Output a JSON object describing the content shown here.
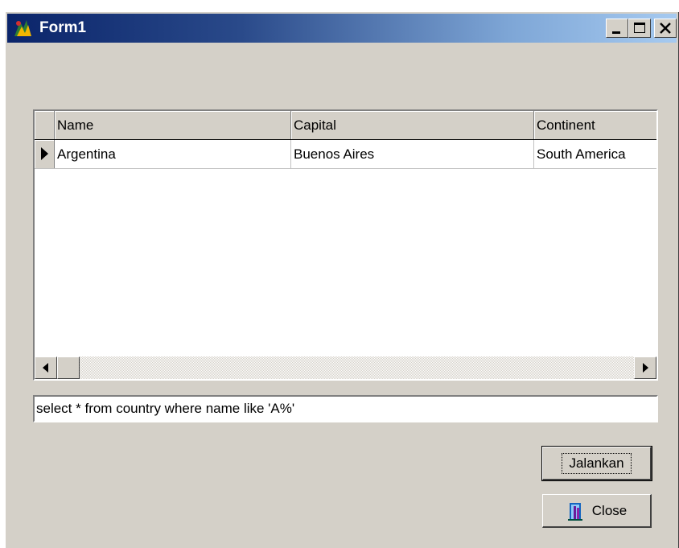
{
  "window": {
    "title": "Form1"
  },
  "titlebar_buttons": [
    "minimize-icon",
    "maximize-icon",
    "close-icon"
  ],
  "grid": {
    "columns": [
      "Name",
      "Capital",
      "Continent"
    ],
    "rows": [
      [
        "Argentina",
        "Buenos Aires",
        "South America"
      ]
    ],
    "current_row_indicator": "triangle-right-icon"
  },
  "query": {
    "value": "select * from country where name like 'A%'"
  },
  "buttons": {
    "run_label": "Jalankan",
    "close_label": "Close"
  },
  "colors": {
    "face": "#d4d0c8",
    "title_start": "#0a246a",
    "title_end": "#a6caf0"
  }
}
